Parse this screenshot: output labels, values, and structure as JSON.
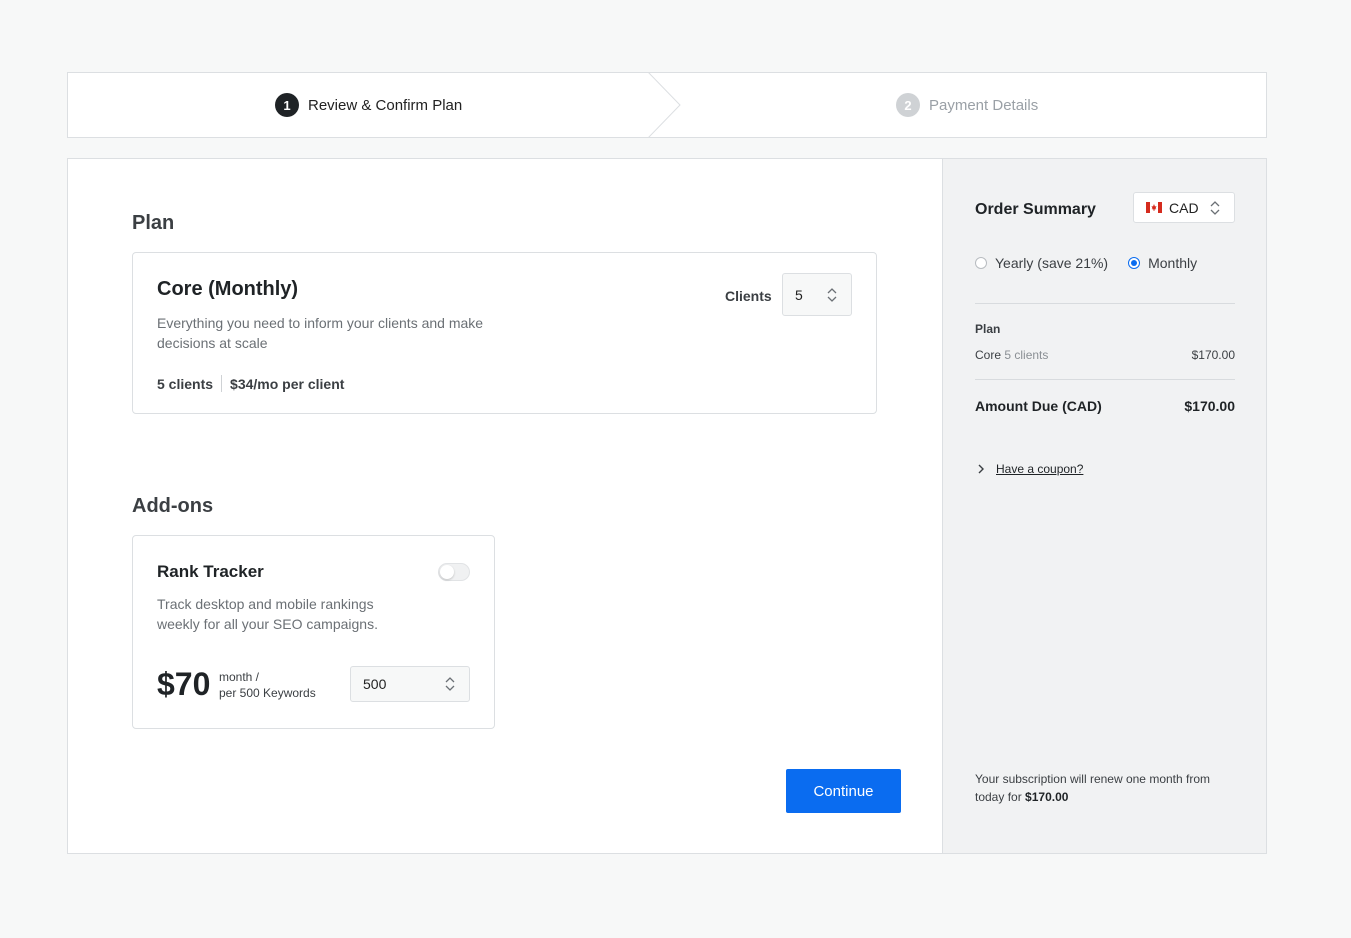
{
  "stepper": {
    "steps": [
      {
        "number": "1",
        "label": "Review & Confirm Plan",
        "state": "active"
      },
      {
        "number": "2",
        "label": "Payment Details",
        "state": "inactive"
      }
    ]
  },
  "plan": {
    "section_title": "Plan",
    "name": "Core (Monthly)",
    "description": "Everything you need to inform your clients and make decisions at scale",
    "clients_summary": "5 clients",
    "price_per_client": "$34/mo per client",
    "clients_label": "Clients",
    "clients_value": "5"
  },
  "addons": {
    "section_title": "Add-ons",
    "items": [
      {
        "name": "Rank Tracker",
        "enabled": false,
        "description": "Track desktop and mobile rankings weekly for all your SEO campaigns.",
        "price": "$70",
        "period_line1": "month /",
        "period_line2": "per 500 Keywords",
        "keywords_value": "500"
      }
    ]
  },
  "actions": {
    "continue_label": "Continue"
  },
  "summary": {
    "title": "Order Summary",
    "currency": "CAD",
    "billing": {
      "yearly_label": "Yearly (save 21%)",
      "monthly_label": "Monthly",
      "selected": "monthly"
    },
    "plan_heading": "Plan",
    "line_name": "Core",
    "line_detail": "5 clients",
    "line_amount": "$170.00",
    "amount_due_label": "Amount Due (CAD)",
    "amount_due_value": "$170.00",
    "coupon_label": "Have a coupon?",
    "renew_text": "Your subscription will renew one month from today for",
    "renew_amount": "$170.00"
  },
  "colors": {
    "accent": "#0a6cf0",
    "flag_red": "#d52b1e",
    "active_step": "#1f2326",
    "inactive_step": "#cfd2d5"
  },
  "icons": [
    "canada-flag-icon",
    "chevron-updown-icon",
    "chevron-right-icon",
    "step-arrow-icon"
  ]
}
